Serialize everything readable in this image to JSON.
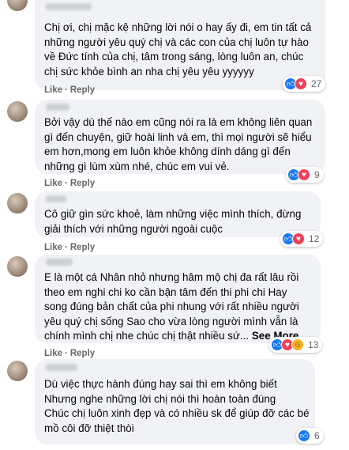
{
  "actions": {
    "like": "Like",
    "reply": "Reply",
    "separator": "·"
  },
  "see_more": "See More",
  "comments": [
    {
      "lines": [
        "Chị ơi, chị mặc kệ những lời nói o hay ấy đi, em tin tất cả",
        "những người yêu quý chị và các con của chị luôn tự hào",
        "về Đức tính của chị, tâm trong sáng, lòng luôn an, chúc",
        "chị sức khỏe bình an nha chị yêu yêu yyyyyy"
      ],
      "reactions": [
        "like",
        "love"
      ],
      "count": "27"
    },
    {
      "lines": [
        "Bởi vậy dù thế nào em cũng nói ra là em không liên quan",
        "gì đến chuyện, giữ hoài linh và em, thì mọi người sẽ hiểu",
        "em hơn,mong em luôn khỏe không dính dáng gì đến",
        "những gì lùm xùm nhé, chúc em vui vẻ."
      ],
      "reactions": [
        "like",
        "love"
      ],
      "count": "9"
    },
    {
      "lines": [
        "Cô giữ gìn sức khoẻ, làm những việc mình thích, đừng",
        "giải thích với những người ngoài cuộc"
      ],
      "reactions": [
        "like",
        "love"
      ],
      "count": "12"
    },
    {
      "lines": [
        "E là một cá Nhân nhỏ nhưng hâm mộ chị đa rất lâu rồi",
        "theo em nghi chi ko cần bận tâm đến thi phi chi Hay",
        "song đúng bản chất của phi nhung với rất nhiều người",
        "yêu quý chị sống Sao cho vừa lòng người mình vẫn là",
        "chính mình chị nhe chúc chị thật nhiều sứ..."
      ],
      "reactions": [
        "like",
        "love",
        "haha"
      ],
      "count": "13"
    },
    {
      "lines": [
        "Dù việc thực hành đúng hay sai thì em không biết",
        "Nhưng nghe những lời chị nói thì hoàn toàn đúng",
        "Chúc chị luôn xinh đẹp và có nhiều sk để giúp đỡ các bé",
        "mồ côi đỡ thiệt thòi"
      ],
      "reactions": [
        "like"
      ],
      "count": "6"
    }
  ]
}
